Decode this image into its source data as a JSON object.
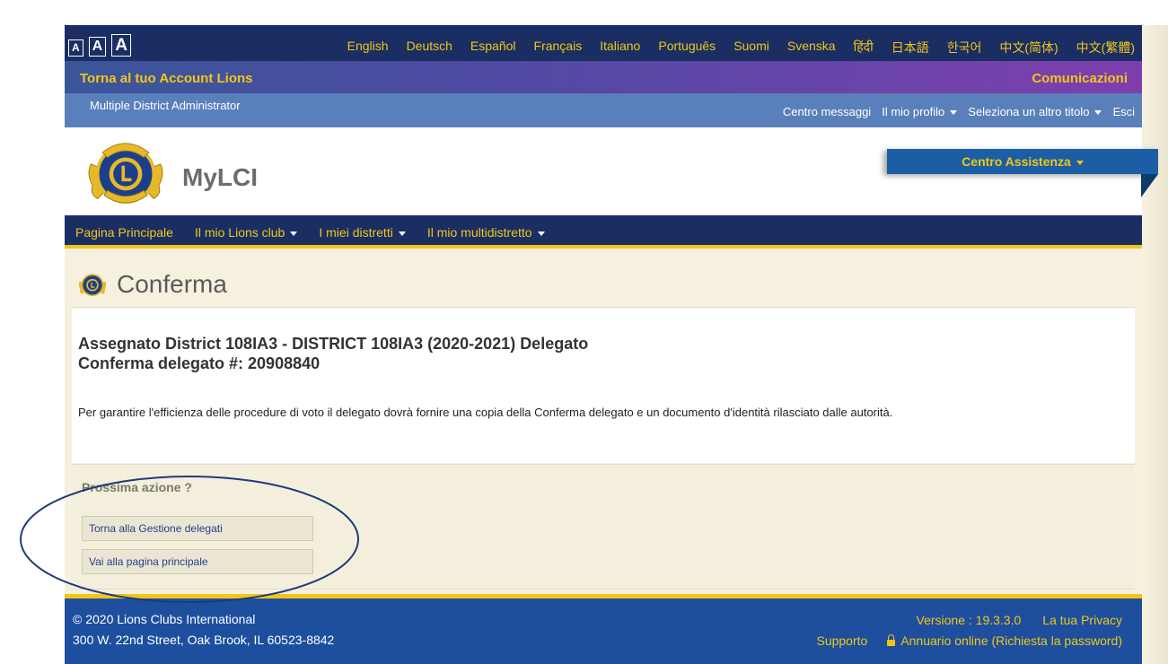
{
  "font_sizes": [
    "A",
    "A",
    "A"
  ],
  "languages": [
    "English",
    "Deutsch",
    "Español",
    "Français",
    "Italiano",
    "Português",
    "Suomi",
    "Svenska",
    "हिंदी",
    "日本語",
    "한국어",
    "中文(简体)",
    "中文(繁體)"
  ],
  "account": {
    "back_label": "Torna al tuo Account Lions",
    "comms_label": "Comunicazioni"
  },
  "user": {
    "role": "Multiple District Administrator",
    "messages": "Centro messaggi",
    "profile": "Il mio profilo",
    "change_title": "Seleziona un altro titolo",
    "logout": "Esci"
  },
  "header": {
    "brand": "MyLCI",
    "assist_label": "Centro Assistenza"
  },
  "mainnav": [
    "Pagina Principale",
    "Il mio Lions club",
    "I miei distretti",
    "Il mio multidistretto"
  ],
  "page": {
    "title": "Conferma"
  },
  "confirmation": {
    "assigned": "Assegnato District 108IA3 - DISTRICT 108IA3 (2020-2021) Delegato",
    "delegate_number": "Conferma delegato #: 20908840",
    "notice": "Per garantire l'efficienza delle procedure di voto il delegato dovrà fornire una copia della Conferma delegato e un documento d'identità rilasciato dalle autorità."
  },
  "next_action": {
    "title": "Prossima azione ?",
    "back_to_delegates": "Torna alla Gestione delegati",
    "go_home": "Vai alla pagina principale"
  },
  "footer": {
    "copyright": "© 2020 Lions Clubs International",
    "address": "300 W. 22nd Street, Oak Brook, IL 60523-8842",
    "version": "Versione : 19.3.3.0",
    "privacy": "La tua Privacy",
    "support": "Supporto",
    "directory": "Annuario online (Richiesta la password)"
  },
  "colors": {
    "navy": "#1a2e63",
    "gold": "#f2c618",
    "footer_blue": "#1d4f9e",
    "role_blue": "#5a80bc",
    "cream": "#f6f1df"
  },
  "icons": [
    "lions-logo-icon",
    "caret-down-icon",
    "lock-icon"
  ]
}
